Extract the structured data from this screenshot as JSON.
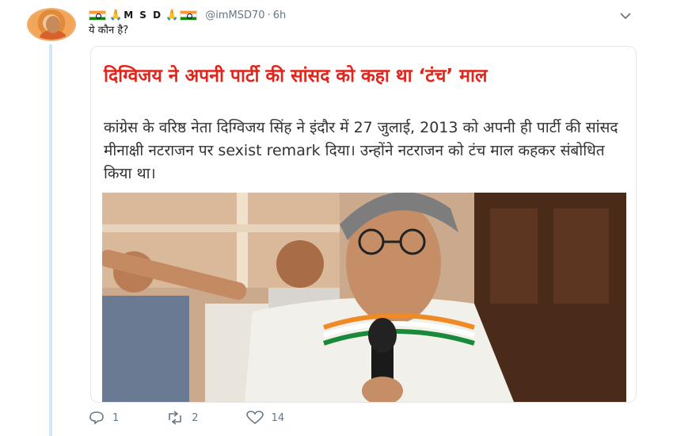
{
  "tweet": {
    "display_name": "M S D",
    "handle": "@imMSD70",
    "separator": "·",
    "time": "6h",
    "text": "ये कौन है?"
  },
  "card": {
    "headline": "दिग्विजय ने अपनी पार्टी की सांसद को कहा था ‘टंच’ माल",
    "body": "कांग्रेस के वरिष्ठ नेता दिग्विजय सिंह ने इंदौर में 27 जुलाई, 2013 को अपनी ही पार्टी की सांसद मीनाक्षी नटराजन पर sexist remark दिया। उन्होंने नटराजन को टंच माल कहकर संबोधित किया था।"
  },
  "actions": {
    "replies": "1",
    "retweets": "2",
    "likes": "14"
  },
  "colors": {
    "headline": "#e0261c",
    "thread_line": "#cfe6f5",
    "muted": "#657786"
  }
}
